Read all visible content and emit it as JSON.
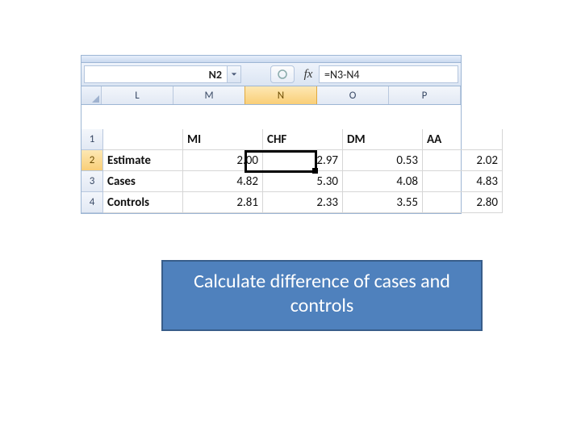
{
  "namebox": {
    "value": "N2"
  },
  "formula_bar": {
    "fx_label": "fx",
    "value": "=N3-N4"
  },
  "columns": [
    "L",
    "M",
    "N",
    "O",
    "P"
  ],
  "active_column_index": 2,
  "active_cell": {
    "col": "N",
    "row": 2
  },
  "rows": [
    {
      "num": "1",
      "active": false,
      "cells": [
        {
          "v": "",
          "t": "txt"
        },
        {
          "v": "MI",
          "t": "txt hdr"
        },
        {
          "v": "CHF",
          "t": "txt hdr"
        },
        {
          "v": "DM",
          "t": "txt hdr"
        },
        {
          "v": "AA",
          "t": "txt hdr"
        }
      ]
    },
    {
      "num": "2",
      "active": true,
      "cells": [
        {
          "v": "Estimate",
          "t": "txt lab"
        },
        {
          "v": "2.00",
          "t": "num"
        },
        {
          "v": "2.97",
          "t": "num"
        },
        {
          "v": "0.53",
          "t": "num"
        },
        {
          "v": "2.02",
          "t": "num"
        }
      ]
    },
    {
      "num": "3",
      "active": false,
      "cells": [
        {
          "v": "Cases",
          "t": "txt lab"
        },
        {
          "v": "4.82",
          "t": "num"
        },
        {
          "v": "5.30",
          "t": "num"
        },
        {
          "v": "4.08",
          "t": "num"
        },
        {
          "v": "4.83",
          "t": "num"
        }
      ]
    },
    {
      "num": "4",
      "active": false,
      "cells": [
        {
          "v": "Controls",
          "t": "txt lab"
        },
        {
          "v": "2.81",
          "t": "num"
        },
        {
          "v": "2.33",
          "t": "num"
        },
        {
          "v": "3.55",
          "t": "num"
        },
        {
          "v": "2.80",
          "t": "num"
        }
      ]
    }
  ],
  "callout": {
    "text": "Calculate difference of cases and controls"
  }
}
